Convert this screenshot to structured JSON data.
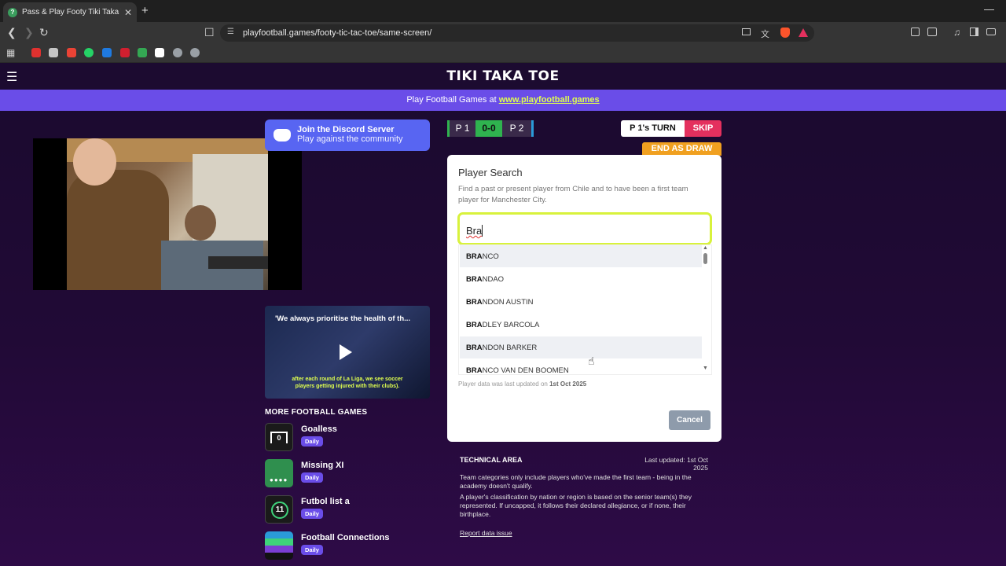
{
  "browser": {
    "tab_title": "Pass & Play Footy Tiki Taka Toe",
    "tab_favicon_letter": "?",
    "tab_close": "✕",
    "new_tab": "+",
    "minimize": "—",
    "url": "playfootball.games/footy-tic-tac-toe/same-screen/",
    "nav_icons": [
      "back-icon",
      "forward-icon",
      "reload-icon",
      "bookmark-icon"
    ],
    "bookmark_colors": [
      "#e0312f",
      "#c5c5c5",
      "#ea4335",
      "#25d366",
      "#1f7ae0",
      "#d01f2f",
      "#34a853",
      "#ffffff",
      "#9aa0a6",
      "#9aa0a6"
    ]
  },
  "site": {
    "logo": "TIKI TAKA TOE",
    "promo_text": "Play Football Games at ",
    "promo_link": "www.playfootball.games"
  },
  "discord": {
    "title": "Join the Discord Server",
    "subtitle": "Play against the community"
  },
  "video": {
    "title": "'We always prioritise the health of th...",
    "caption": "after each round of La Liga, we see soccer players getting injured with their clubs)."
  },
  "more_games": {
    "title": "MORE FOOTBALL GAMES",
    "items": [
      {
        "name": "Goalless",
        "badge": "Daily",
        "icon_text": "0",
        "color": "#1a1a1a"
      },
      {
        "name": "Missing XI",
        "badge": "Daily",
        "icon_text": "",
        "color": "#2f8f4e"
      },
      {
        "name": "Futbol list a",
        "badge": "Daily",
        "icon_text": "11",
        "color": "#1a1a1a"
      },
      {
        "name": "Football Connections",
        "badge": "Daily",
        "icon_text": "",
        "color": "#2a9bd8"
      }
    ]
  },
  "score": {
    "p1": "P 1",
    "score": "0-0",
    "p2": "P 2",
    "turn": "P 1's TURN",
    "skip": "SKIP",
    "draw": "END AS DRAW"
  },
  "search": {
    "title": "Player Search",
    "description": "Find a past or present player from Chile and to have been a first team player for Manchester City.",
    "query": "Bra",
    "results": [
      {
        "match": "BRA",
        "rest": "NCO",
        "highlight": true
      },
      {
        "match": "BRA",
        "rest": "NDAO",
        "highlight": false
      },
      {
        "match": "BRA",
        "rest": "NDON AUSTIN",
        "highlight": false
      },
      {
        "match": "BRA",
        "rest": "DLEY BARCOLA",
        "highlight": false
      },
      {
        "match": "BRA",
        "rest": "NDON BARKER",
        "highlight": true
      },
      {
        "match": "BRA",
        "rest": "NCO VAN DEN BOOMEN",
        "highlight": false
      }
    ],
    "updated_label": "Player data was last updated on ",
    "updated_date": "1st Oct 2025",
    "cancel": "Cancel"
  },
  "tech": {
    "title": "TECHNICAL AREA",
    "last_updated": "Last updated: 1st Oct 2025",
    "p1": "Team categories only include players who've made the first team - being in the academy doesn't qualify.",
    "p2": "A player's classification by nation or region is based on the senior team(s) they represented. If uncapped, it follows their declared allegiance, or if none, their birthplace.",
    "report": "Report data issue"
  },
  "colors": {
    "accent": "#6a4de8",
    "highlight": "#d8f23c",
    "skip": "#e4305e",
    "draw": "#f0a020",
    "discord": "#5865f2"
  }
}
